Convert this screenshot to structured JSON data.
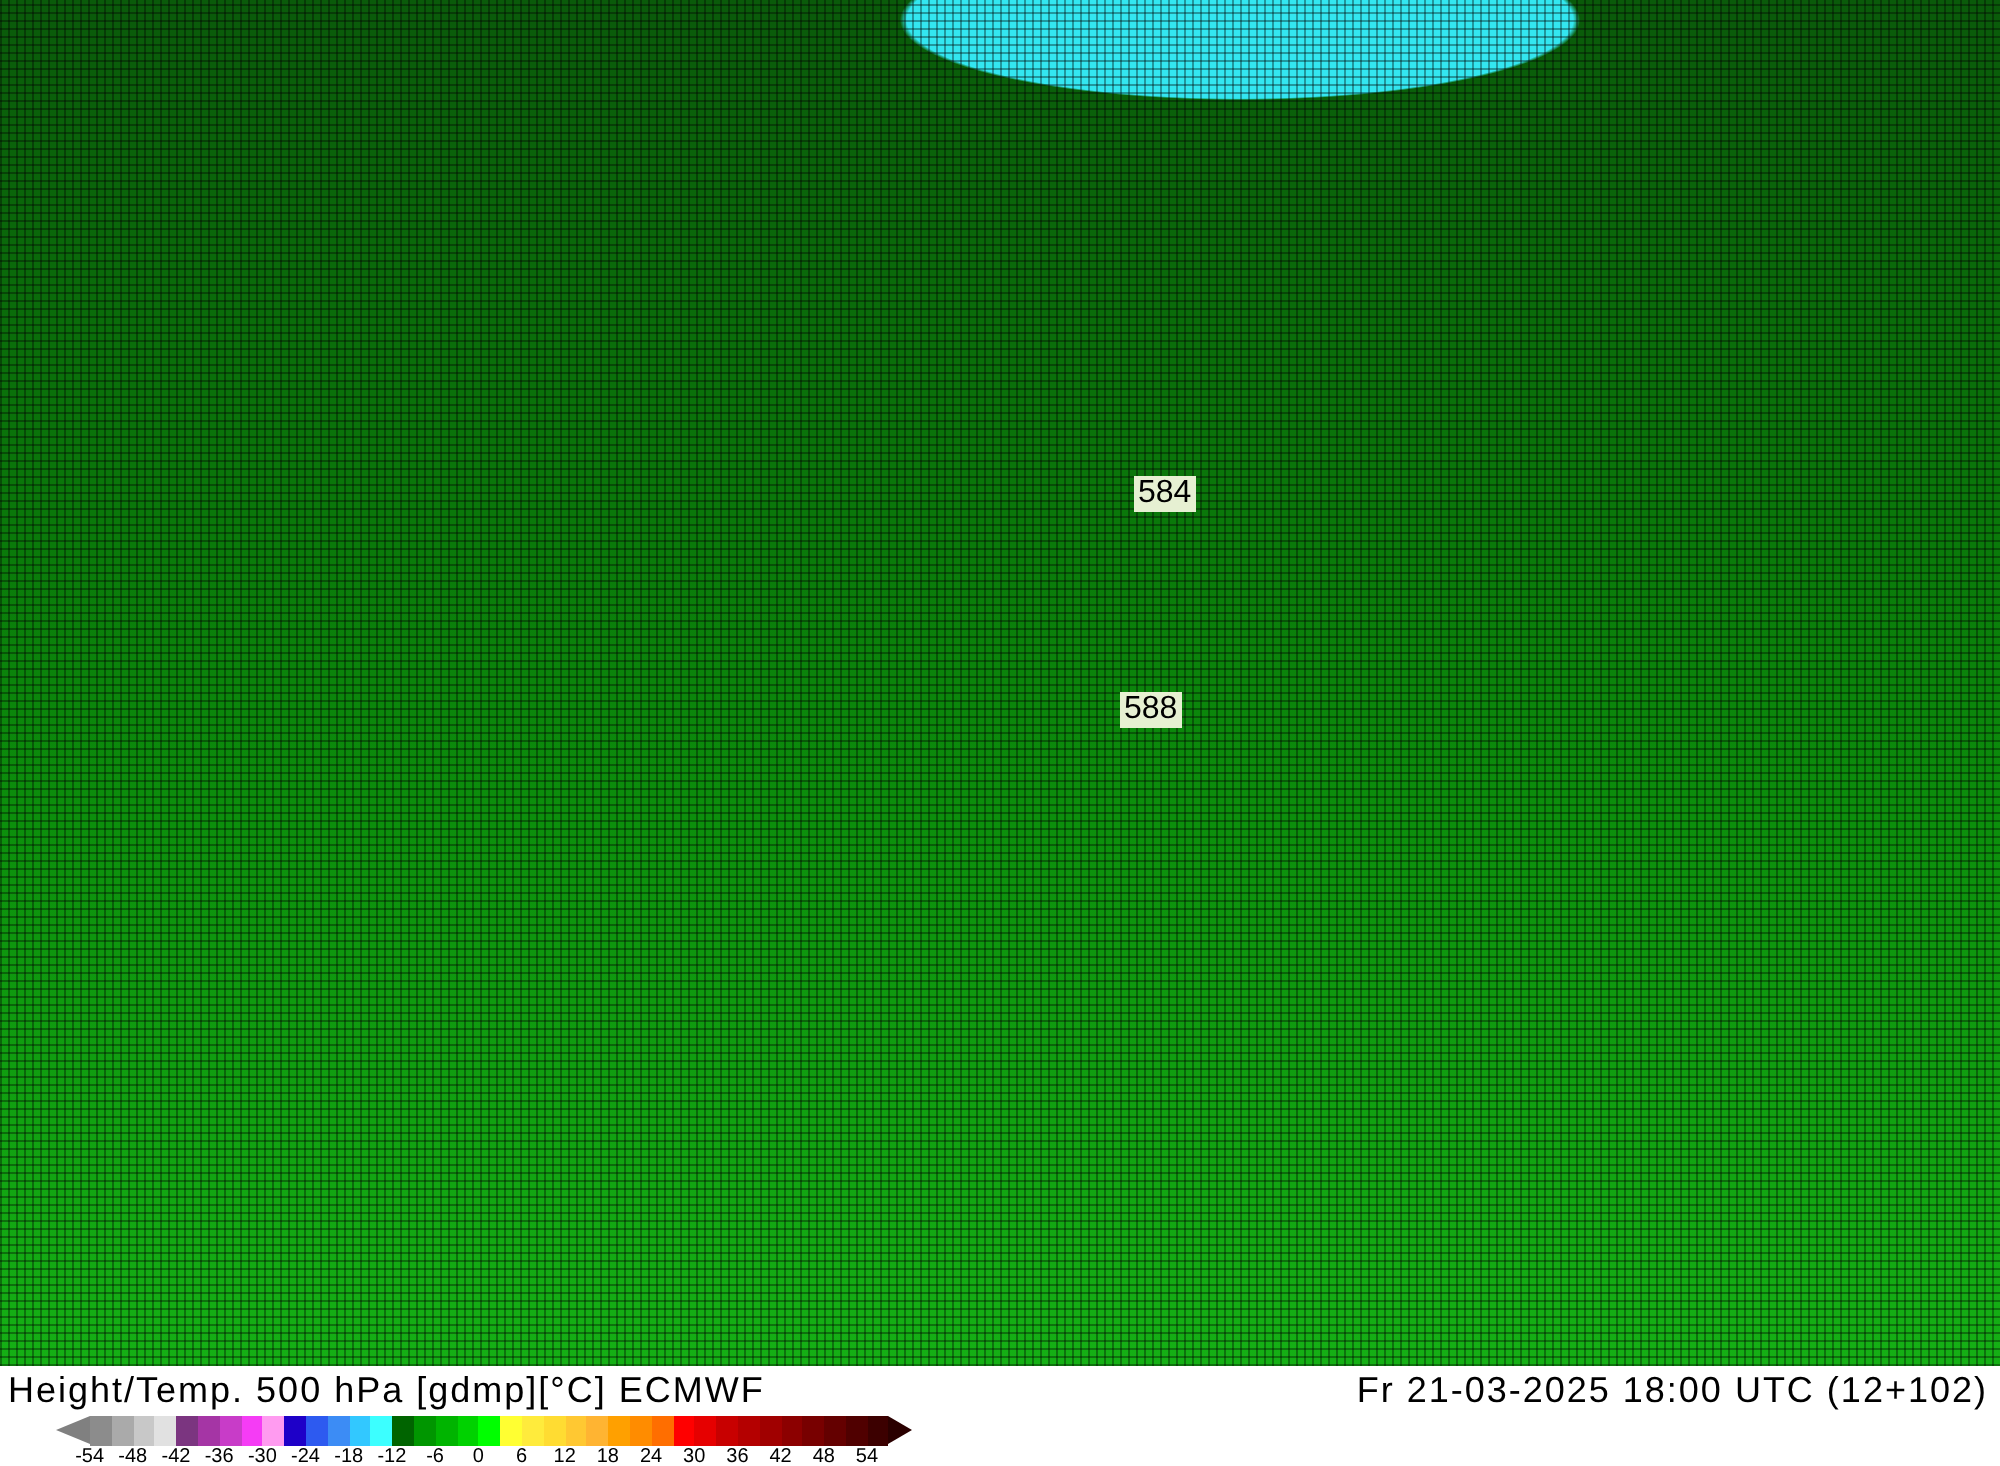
{
  "map": {
    "contour_labels": [
      {
        "text": "584"
      },
      {
        "text": "588"
      }
    ]
  },
  "title": "Height/Temp. 500 hPa [gdmp][°C] ECMWF",
  "valid_time": "Fr 21-03-2025 18:00 UTC (12+102)",
  "colorbar": {
    "swatches": [
      {
        "kind": "low_arrow",
        "color": "#808080"
      },
      {
        "color": "#8c8c8c"
      },
      {
        "color": "#aaaaaa"
      },
      {
        "color": "#c8c8c8"
      },
      {
        "color": "#e1e1e1"
      },
      {
        "color": "#7b3580"
      },
      {
        "color": "#a535a5"
      },
      {
        "color": "#c83cc8"
      },
      {
        "color": "#f53cf5"
      },
      {
        "color": "#ff9bf0"
      },
      {
        "color": "#1e00c8"
      },
      {
        "color": "#2d5af0"
      },
      {
        "color": "#3c8cf5"
      },
      {
        "color": "#32c8ff"
      },
      {
        "color": "#3cffff"
      },
      {
        "color": "#006400"
      },
      {
        "color": "#009600"
      },
      {
        "color": "#00b400"
      },
      {
        "color": "#00d200"
      },
      {
        "color": "#00ff00"
      },
      {
        "color": "#ffff32"
      },
      {
        "color": "#ffeb3c"
      },
      {
        "color": "#ffdc32"
      },
      {
        "color": "#ffc832"
      },
      {
        "color": "#ffb432"
      },
      {
        "color": "#ffa000"
      },
      {
        "color": "#ff8c00"
      },
      {
        "color": "#ff6e00"
      },
      {
        "color": "#ff0000"
      },
      {
        "color": "#e60000"
      },
      {
        "color": "#c80000"
      },
      {
        "color": "#b40000"
      },
      {
        "color": "#a00000"
      },
      {
        "color": "#8c0000"
      },
      {
        "color": "#780000"
      },
      {
        "color": "#640000"
      },
      {
        "color": "#500000"
      },
      {
        "color": "#3c0000"
      },
      {
        "kind": "high_arrow",
        "color": "#2a0000"
      }
    ],
    "ticks": [
      "-54",
      "-48",
      "-42",
      "-36",
      "-30",
      "-24",
      "-18",
      "-12",
      "-6",
      "0",
      "6",
      "12",
      "18",
      "24",
      "30",
      "36",
      "42",
      "48",
      "54"
    ]
  }
}
